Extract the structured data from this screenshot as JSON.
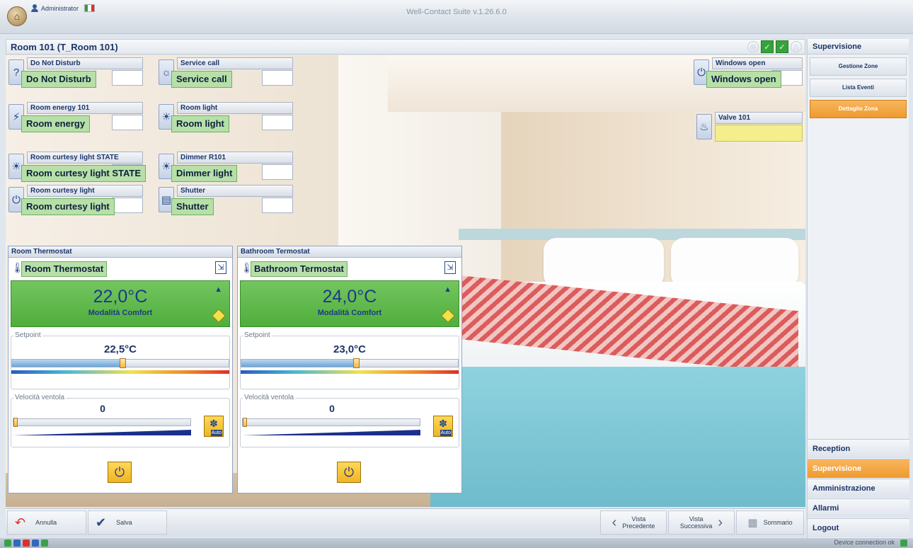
{
  "app": {
    "title": "Well-Contact Suite v.1.26.6.0",
    "user": "Administrator"
  },
  "room": {
    "title": "Room 101 (T_Room 101)"
  },
  "devices": [
    {
      "label": "Do Not Disturb",
      "status": "Do Not Disturb",
      "icon": "question-icon"
    },
    {
      "label": "Service call",
      "status": "Service call",
      "icon": "service-call-icon"
    },
    {
      "label": "Room energy 101",
      "status": "Room energy",
      "icon": "energy-icon"
    },
    {
      "label": "Room light",
      "status": "Room light",
      "icon": "light-icon"
    },
    {
      "label": "Room curtesy light STATE",
      "status": "Room curtesy light STATE",
      "icon": "light-icon"
    },
    {
      "label": "Dimmer R101",
      "status": "Dimmer light",
      "icon": "dimmer-icon"
    },
    {
      "label": "Room curtesy light",
      "status": "Room curtesy light",
      "icon": "power-icon"
    },
    {
      "label": "Shutter",
      "status": "Shutter",
      "icon": "shutter-icon"
    },
    {
      "label": "Windows open",
      "status": "Windows open",
      "icon": "power-icon"
    },
    {
      "label": "Valve 101",
      "status": "",
      "icon": "valve-icon"
    }
  ],
  "thermostats": [
    {
      "header": "Room Thermostat",
      "name": "Room Thermostat",
      "temperature": "22,0°C",
      "mode": "Modalità Comfort",
      "setpoint_label": "Setpoint",
      "setpoint": "22,5°C",
      "setpoint_fraction": 0.51,
      "fan_label": "Velocità ventola",
      "fan_speed": "0",
      "fan_auto_label": "Auto"
    },
    {
      "header": "Bathroom Termostat",
      "name": "Bathroom Termostat",
      "temperature": "24,0°C",
      "mode": "Modalità Comfort",
      "setpoint_label": "Setpoint",
      "setpoint": "23,0°C",
      "setpoint_fraction": 0.53,
      "fan_label": "Velocità ventola",
      "fan_speed": "0",
      "fan_auto_label": "Auto"
    }
  ],
  "sidebar": {
    "header": "Supervisione",
    "subitems": [
      {
        "label": "Gestione Zone",
        "active": false
      },
      {
        "label": "Lista Eventi",
        "active": false
      },
      {
        "label": "Dettaglio Zona",
        "active": true
      }
    ],
    "main_items": [
      {
        "label": "Reception",
        "active": false
      },
      {
        "label": "Supervisione",
        "active": true
      },
      {
        "label": "Amministrazione",
        "active": false
      },
      {
        "label": "Allarmi",
        "active": false
      },
      {
        "label": "Logout",
        "active": false
      }
    ]
  },
  "toolbar": {
    "cancel_label": "Annulla",
    "save_label": "Salva",
    "prev_line1": "Vista",
    "prev_line2": "Precedente",
    "next_line1": "Vista",
    "next_line2": "Successiva",
    "summary_label": "Sommario"
  },
  "status": {
    "text": "Device connection ok"
  },
  "colors": {
    "accent": "#ef9a2c",
    "status_green": "#b6e0a8",
    "display_green": "#4fae3c",
    "valve_yellow": "#f4ee8c"
  }
}
